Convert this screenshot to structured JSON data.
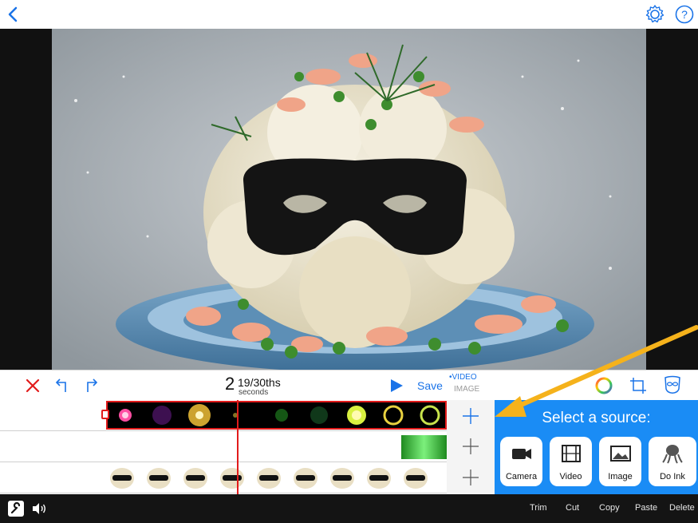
{
  "header": {
    "back_icon": "chevron-left-icon",
    "settings_icon": "gear-icon",
    "help_icon": "help-circle-icon"
  },
  "preview": {
    "image_icon": "preview-image"
  },
  "controls": {
    "time_whole": "2",
    "time_fraction": "19/30ths",
    "time_unit": "seconds",
    "save_label": "Save",
    "mode_video": "•VIDEO",
    "mode_image": "IMAGE"
  },
  "source_panel": {
    "title": "Select a source:",
    "buttons": [
      {
        "label": "Camera",
        "icon": "camera-icon"
      },
      {
        "label": "Video",
        "icon": "film-icon"
      },
      {
        "label": "Image",
        "icon": "image-icon"
      },
      {
        "label": "Do Ink",
        "icon": "octopus-icon"
      }
    ]
  },
  "bottom_bar": {
    "commands": [
      "Trim",
      "Cut",
      "Copy",
      "Paste",
      "Delete"
    ]
  },
  "colors": {
    "accent_blue": "#1a8cf5",
    "record_red": "#e21b1b",
    "arrow_orange": "#f5b21b"
  }
}
